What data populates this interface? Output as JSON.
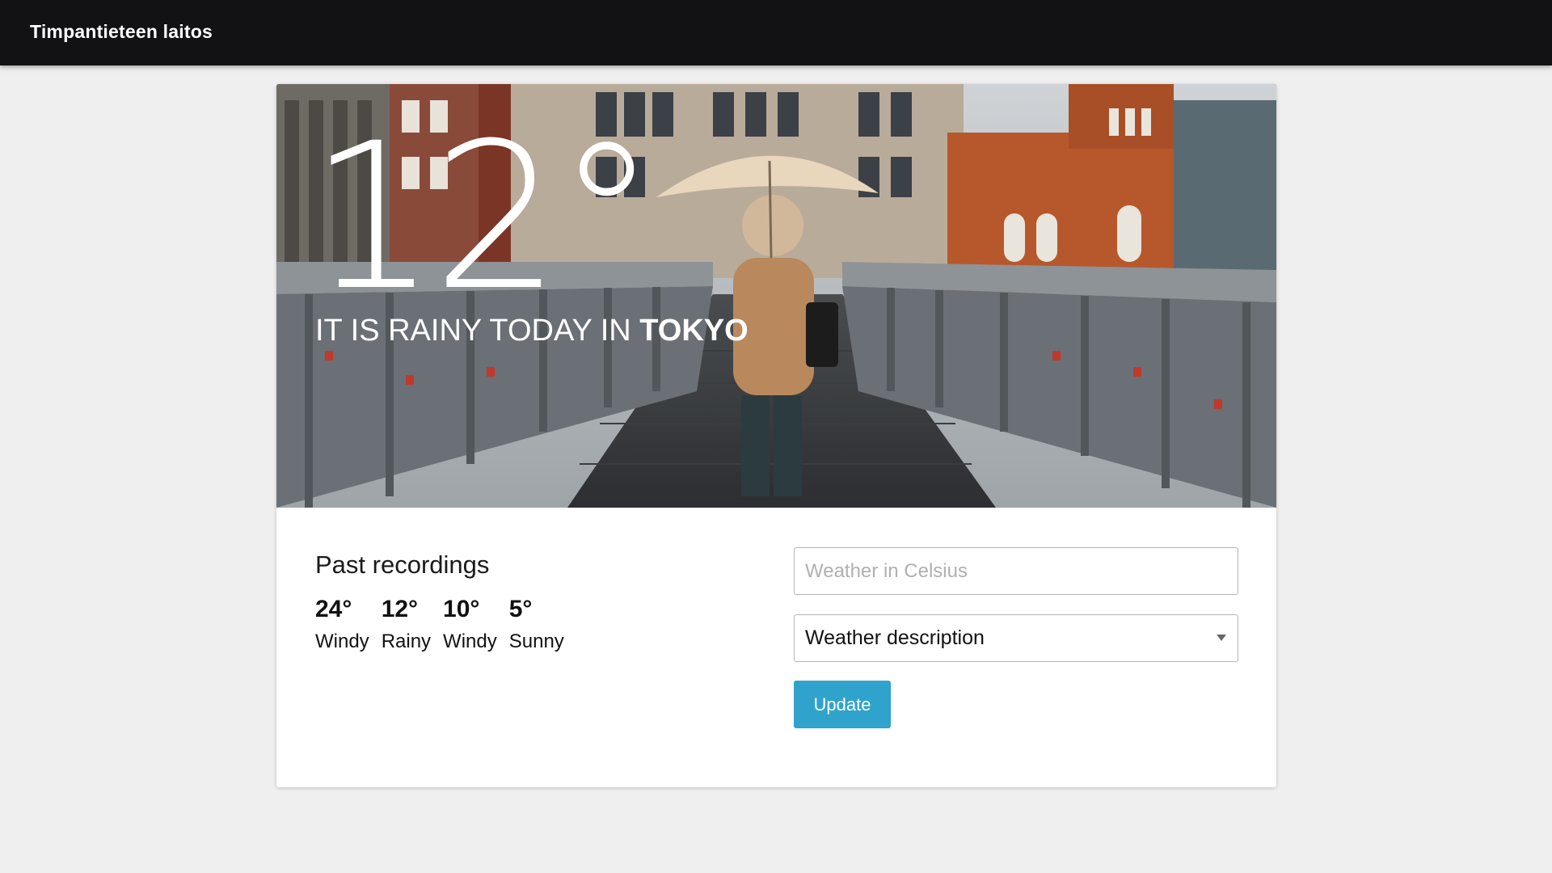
{
  "navbar": {
    "brand": "Timpantieteen laitos"
  },
  "hero": {
    "temperature": "12°",
    "headline_prefix": "IT IS RAINY TODAY IN ",
    "city": "TOKYO"
  },
  "recordings": {
    "title": "Past recordings",
    "items": [
      {
        "temp": "24°",
        "desc": "Windy"
      },
      {
        "temp": "12°",
        "desc": "Rainy"
      },
      {
        "temp": "10°",
        "desc": "Windy"
      },
      {
        "temp": "5°",
        "desc": "Sunny"
      }
    ]
  },
  "form": {
    "celsius_placeholder": "Weather in Celsius",
    "description_selected": "Weather description",
    "update_label": "Update"
  },
  "colors": {
    "navbar": "#121214",
    "button": "#2fa3cc",
    "background": "#efefef"
  }
}
